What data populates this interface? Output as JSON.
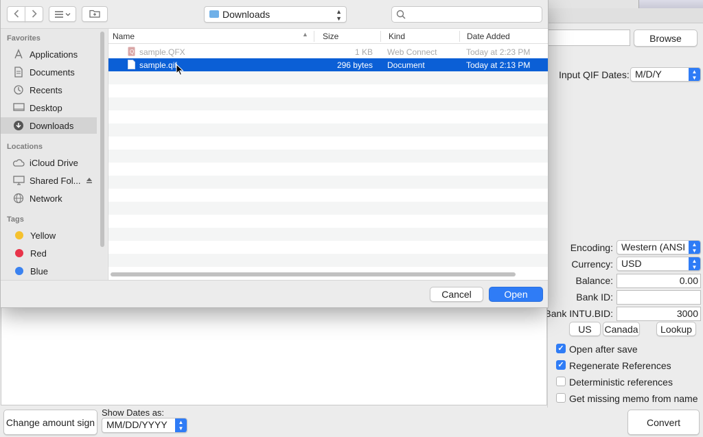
{
  "dialog": {
    "location": "Downloads",
    "search_placeholder": "",
    "sidebar": {
      "favorites_header": "Favorites",
      "favorites": [
        {
          "label": "Applications",
          "icon": "applications-icon"
        },
        {
          "label": "Documents",
          "icon": "documents-icon"
        },
        {
          "label": "Recents",
          "icon": "recents-icon"
        },
        {
          "label": "Desktop",
          "icon": "desktop-icon"
        },
        {
          "label": "Downloads",
          "icon": "downloads-icon",
          "active": true
        }
      ],
      "locations_header": "Locations",
      "locations": [
        {
          "label": "iCloud Drive",
          "icon": "cloud-icon"
        },
        {
          "label": "Shared Fol...",
          "icon": "display-icon"
        },
        {
          "label": "Network",
          "icon": "network-icon"
        }
      ],
      "tags_header": "Tags",
      "tags": [
        {
          "label": "Yellow",
          "color": "#f5c12e"
        },
        {
          "label": "Red",
          "color": "#e8344a"
        },
        {
          "label": "Blue",
          "color": "#3a82f0"
        }
      ]
    },
    "columns": {
      "name": "Name",
      "size": "Size",
      "kind": "Kind",
      "date": "Date Added"
    },
    "files": [
      {
        "name": "sample.QFX",
        "size": "1 KB",
        "kind": "Web Connect",
        "date": "Today at 2:23 PM",
        "state": "disabled"
      },
      {
        "name": "sample.qif",
        "size": "296 bytes",
        "kind": "Document",
        "date": "Today at 2:13 PM",
        "state": "selected"
      }
    ],
    "buttons": {
      "cancel": "Cancel",
      "open": "Open"
    }
  },
  "app": {
    "browse_label": "Browse",
    "input_qif_dates_label": "Input QIF Dates:",
    "input_qif_dates_value": "M/D/Y",
    "encoding_label": "Encoding:",
    "encoding_value": "Western (ANSI",
    "currency_label": "Currency:",
    "currency_value": "USD",
    "balance_label": "Balance:",
    "balance_value": "0.00",
    "bank_id_label": "Bank ID:",
    "bank_id_value": "",
    "bank_intu_label": "Bank INTU.BID:",
    "bank_intu_value": "3000",
    "us_label": "US",
    "canada_label": "Canada",
    "lookup_label": "Lookup",
    "options": [
      {
        "label": "Open after save",
        "checked": true
      },
      {
        "label": "Regenerate References",
        "checked": true
      },
      {
        "label": "Deterministic references",
        "checked": false
      },
      {
        "label": "Get missing memo from name",
        "checked": false
      }
    ],
    "change_amount_sign_label": "Change amount sign",
    "show_dates_label": "Show Dates as:",
    "show_dates_value": "MM/DD/YYYY",
    "convert_label": "Convert"
  }
}
